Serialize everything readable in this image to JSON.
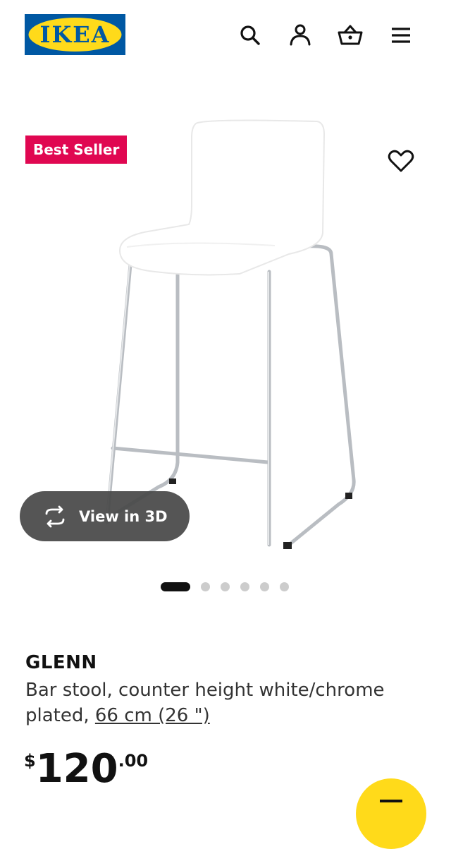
{
  "header": {
    "logo_text": "IKEA",
    "icons": [
      "search-icon",
      "account-icon",
      "shopping-bag-icon",
      "hamburger-menu-icon"
    ]
  },
  "gallery": {
    "badge": "Best Seller",
    "view_3d_label": "View in 3D",
    "slide_count": 6,
    "active_slide": 1
  },
  "product": {
    "name": "GLENN",
    "description": "Bar stool, counter height white/chrome plated,",
    "measurement": "66 cm (26 \")",
    "price": {
      "currency": "$",
      "integer": "120",
      "decimal": ".00"
    }
  },
  "colors": {
    "ikea_blue": "#0058a3",
    "ikea_yellow": "#ffda1a",
    "badge_red": "#e00751",
    "text": "#111111"
  }
}
